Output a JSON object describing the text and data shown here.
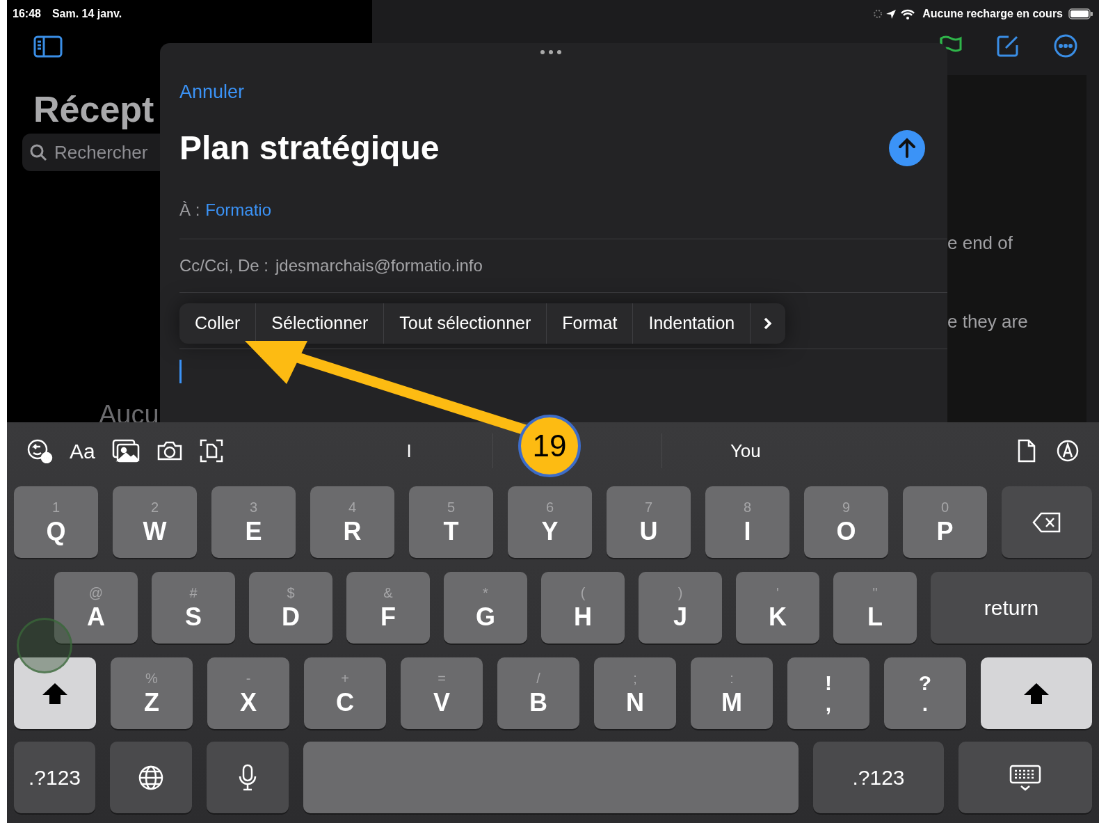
{
  "status_bar": {
    "time": "16:48",
    "date": "Sam. 14 janv.",
    "battery_text": "Aucune recharge en cours"
  },
  "sidebar": {
    "title": "Récept",
    "search": {
      "placeholder": "Rechercher"
    },
    "empty_text": "Aucu"
  },
  "message_preview": {
    "lines": [
      "e end of",
      "e they are"
    ]
  },
  "compose": {
    "cancel": "Annuler",
    "subject": "Plan stratégique",
    "to_label": "À :",
    "to": "Formatio",
    "cc_from_label": "Cc/Cci, De :",
    "from": "jdesmarchais@formatio.info",
    "edit_menu": [
      "Coller",
      "Sélectionner",
      "Tout sélectionner",
      "Format",
      "Indentation"
    ]
  },
  "keyboard": {
    "format_label": "Aa",
    "suggestions": [
      {
        "text": "I"
      },
      {
        "text": "You"
      }
    ],
    "rows": [
      {
        "keys": [
          {
            "kind": "letter",
            "label": "Q",
            "alt": "1"
          },
          {
            "kind": "letter",
            "label": "W",
            "alt": "2"
          },
          {
            "kind": "letter",
            "label": "E",
            "alt": "3"
          },
          {
            "kind": "letter",
            "label": "R",
            "alt": "4"
          },
          {
            "kind": "letter",
            "label": "T",
            "alt": "5"
          },
          {
            "kind": "letter",
            "label": "Y",
            "alt": "6"
          },
          {
            "kind": "letter",
            "label": "U",
            "alt": "7"
          },
          {
            "kind": "letter",
            "label": "I",
            "alt": "8"
          },
          {
            "kind": "letter",
            "label": "O",
            "alt": "9"
          },
          {
            "kind": "letter",
            "label": "P",
            "alt": "0"
          },
          {
            "kind": "delete"
          }
        ]
      },
      {
        "keys": [
          {
            "kind": "letter",
            "label": "A",
            "alt": "@"
          },
          {
            "kind": "letter",
            "label": "S",
            "alt": "#"
          },
          {
            "kind": "letter",
            "label": "D",
            "alt": "$"
          },
          {
            "kind": "letter",
            "label": "F",
            "alt": "&"
          },
          {
            "kind": "letter",
            "label": "G",
            "alt": "*"
          },
          {
            "kind": "letter",
            "label": "H",
            "alt": "("
          },
          {
            "kind": "letter",
            "label": "J",
            "alt": ")"
          },
          {
            "kind": "letter",
            "label": "K",
            "alt": "'"
          },
          {
            "kind": "letter",
            "label": "L",
            "alt": "\""
          },
          {
            "kind": "return",
            "label": "return"
          }
        ]
      },
      {
        "keys": [
          {
            "kind": "shift",
            "on": true
          },
          {
            "kind": "letter",
            "label": "Z",
            "alt": "%"
          },
          {
            "kind": "letter",
            "label": "X",
            "alt": "-"
          },
          {
            "kind": "letter",
            "label": "C",
            "alt": "+"
          },
          {
            "kind": "letter",
            "label": "V",
            "alt": "="
          },
          {
            "kind": "letter",
            "label": "B",
            "alt": "/"
          },
          {
            "kind": "letter",
            "label": "N",
            "alt": ";"
          },
          {
            "kind": "letter",
            "label": "M",
            "alt": ":"
          },
          {
            "kind": "punct",
            "label": ",",
            "alt": "!"
          },
          {
            "kind": "punct",
            "label": ".",
            "alt": "?"
          },
          {
            "kind": "shift",
            "on": true
          }
        ]
      },
      {
        "keys": [
          {
            "kind": "numbers",
            "label": ".?123"
          },
          {
            "kind": "globe"
          },
          {
            "kind": "mic"
          },
          {
            "kind": "space"
          },
          {
            "kind": "numbers",
            "label": ".?123"
          },
          {
            "kind": "hide"
          }
        ]
      }
    ]
  },
  "annotation": {
    "number": "19"
  }
}
